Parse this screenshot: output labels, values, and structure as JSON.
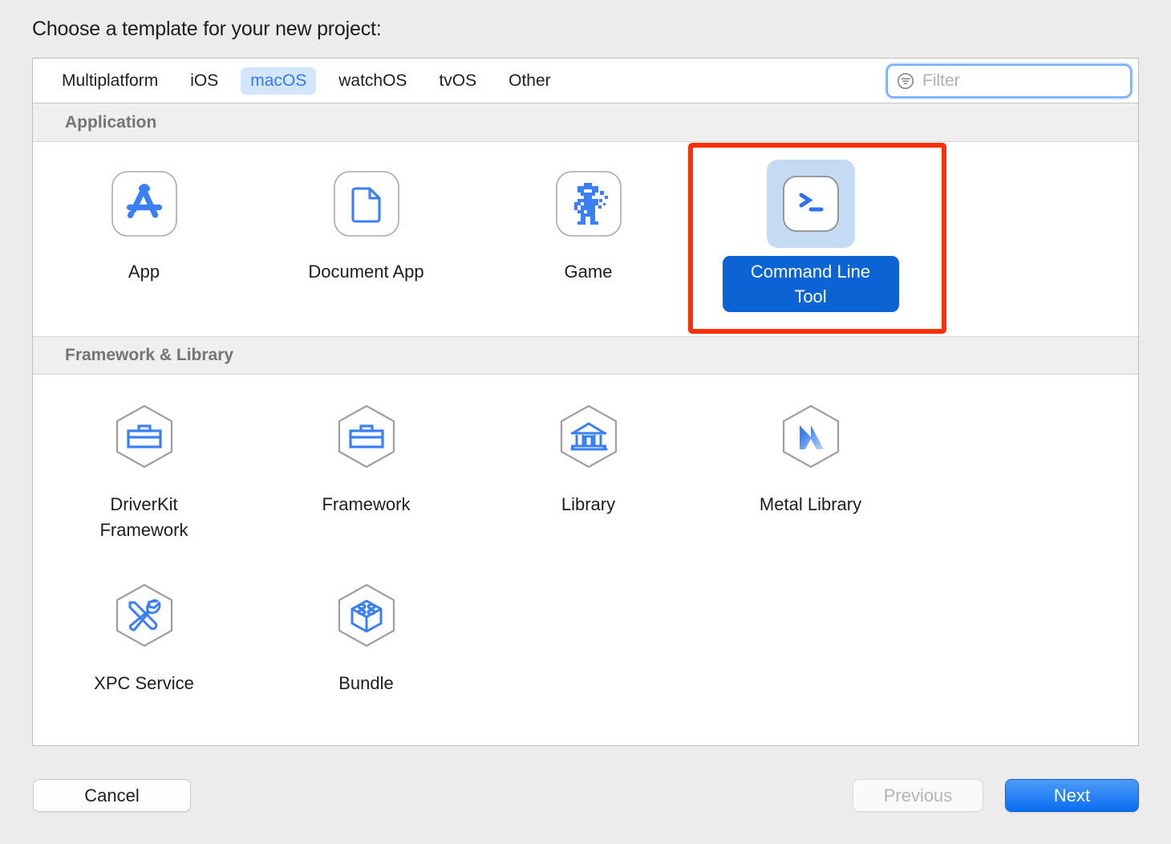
{
  "title": "Choose a template for your new project:",
  "tabs": [
    {
      "label": "Multiplatform",
      "selected": false
    },
    {
      "label": "iOS",
      "selected": false
    },
    {
      "label": "macOS",
      "selected": true
    },
    {
      "label": "watchOS",
      "selected": false
    },
    {
      "label": "tvOS",
      "selected": false
    },
    {
      "label": "Other",
      "selected": false
    }
  ],
  "filter": {
    "placeholder": "Filter",
    "value": "",
    "icon": "filter-circle-icon",
    "focused": true
  },
  "sections": [
    {
      "header": "Application",
      "items": [
        {
          "label": "App",
          "icon": "app-store-logo-icon",
          "selected": false
        },
        {
          "label": "Document App",
          "icon": "document-page-icon",
          "selected": false
        },
        {
          "label": "Game",
          "icon": "pixel-robot-icon",
          "selected": false
        },
        {
          "label": "Command Line Tool",
          "icon": "terminal-prompt-icon",
          "selected": true
        }
      ]
    },
    {
      "header": "Framework & Library",
      "items": [
        {
          "label": "DriverKit Framework",
          "icon": "hexagon-toolbox-icon",
          "selected": false
        },
        {
          "label": "Framework",
          "icon": "hexagon-toolbox-icon",
          "selected": false
        },
        {
          "label": "Library",
          "icon": "hexagon-bank-icon",
          "selected": false
        },
        {
          "label": "Metal Library",
          "icon": "hexagon-metal-m-icon",
          "selected": false
        },
        {
          "label": "XPC Service",
          "icon": "hexagon-tools-icon",
          "selected": false
        },
        {
          "label": "Bundle",
          "icon": "hexagon-cube-icon",
          "selected": false
        }
      ]
    }
  ],
  "footer": {
    "cancel": "Cancel",
    "previous": "Previous",
    "next": "Next",
    "previous_disabled": true
  },
  "annotation": {
    "type": "highlight-rectangle",
    "color": "#F7310C",
    "target": "Command Line Tool"
  },
  "colors": {
    "accent_blue": "#3B7FF6",
    "selected_pill": "#0B63D4",
    "tab_selected_bg": "#D3E6FD",
    "icon_highlight_bg": "#C5DBF4",
    "page_bg": "#ECECEC",
    "hexagon_stroke": "#9E9E9E"
  }
}
